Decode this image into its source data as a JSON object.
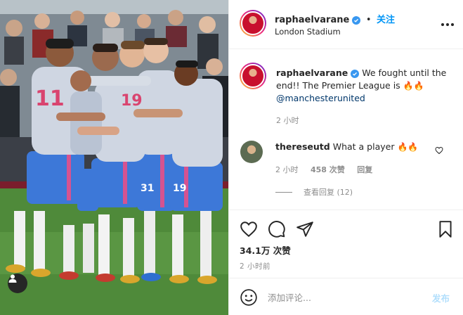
{
  "post": {
    "username": "raphaelvarane",
    "follow_label": "关注",
    "separator": "•",
    "location": "London Stadium"
  },
  "caption": {
    "username": "raphaelvarane",
    "text_before": "We fought until the end!! The Premier League is",
    "emoji": "🔥🔥",
    "mention": "@manchesterunited",
    "time": "2 小时"
  },
  "comment": {
    "username": "thereseutd",
    "text": "What a player",
    "emoji": "🔥🔥",
    "time": "2 小时",
    "likes": "458 次赞",
    "reply_label": "回复",
    "view_replies": "查看回复 (12)"
  },
  "engagement": {
    "likes": "34.1万 次赞",
    "time": "2 小时前"
  },
  "compose": {
    "placeholder": "添加评论...",
    "post_label": "发布"
  },
  "photo": {
    "jersey_numbers": [
      "11",
      "19",
      "31",
      "19"
    ]
  },
  "colors": {
    "accent": "#0095f6",
    "verified": "#3897f0",
    "secondary_text": "#8e8e8e",
    "mention": "#00376b"
  },
  "icons": {
    "verified": "verified-badge-icon",
    "more": "more-options-icon",
    "like": "heart-icon",
    "comment": "comment-bubble-icon",
    "share": "paper-plane-icon",
    "save": "bookmark-icon",
    "emoji": "smiley-icon",
    "user_tags": "user-silhouette-icon"
  }
}
